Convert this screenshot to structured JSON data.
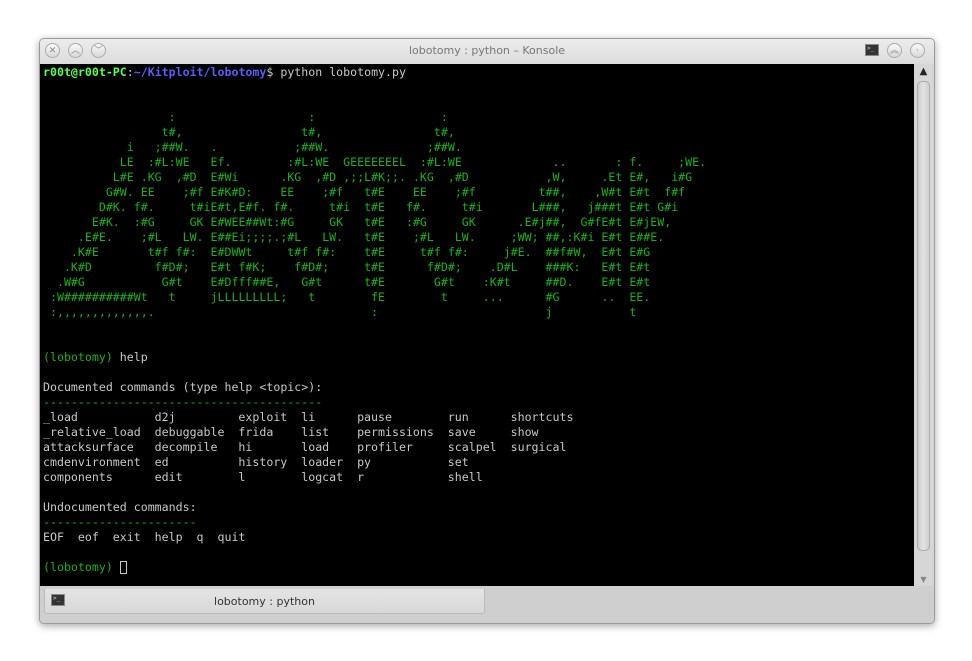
{
  "window": {
    "title": "lobotomy : python – Konsole"
  },
  "terminal": {
    "prompt_user": "r00t@r00t-PC",
    "prompt_sep": ":",
    "prompt_path": "~/Kitploit/lobotomy",
    "prompt_command": "$ python lobotomy.py",
    "art": {
      "lines": [
        "                  :                   :                  :",
        "                 t#,                 t#,                t#,",
        "            i   ;##W.   .           ;##W.              ;##W.",
        "           LE  :#L:WE   Ef.        :#L:WE  GEEEEEEEL  :#L:WE             ..       : f.     ;WE.",
        "          L#E .KG  ,#D  E#Wi      .KG  ,#D ,;;L#K;;. .KG  ,#D           ,W,     .Et E#,   i#G",
        "         G#W. EE    ;#f E#K#D:    EE    ;#f   t#E    EE    ;#f         t##,    ,W#t E#t  f#f",
        "        D#K. f#.     t#iE#t,E#f. f#.     t#i  t#E   f#.     t#i       L###,   j###t E#t G#i",
        "       E#K.  :#G     GK E#WEE##Wt:#G     GK   t#E   :#G     GK      .E#j##,  G#fE#t E#jEW,",
        "     .E#E.    ;#L   LW. E##Ei;;;;.;#L   LW.   t#E    ;#L   LW.     ;WW; ##,:K#i E#t E##E.",
        "    .K#E       t#f f#:  E#DWWt     t#f f#:    t#E     t#f f#:     j#E.  ##f#W,  E#t E#G",
        "   .K#D         f#D#;   E#t f#K;    f#D#;     t#E      f#D#;    .D#L    ###K:   E#t E#t",
        "  .W#G           G#t    E#Dfff##E,   G#t      t#E       G#t    :K#t     ##D.    E#t E#t",
        " :W##########Wt   t     jLLLLLLLLL;   t        fE        t     ...      #G      ..  EE.",
        " :,,,,,,,,,,,,,.                               :                        j           t"
      ]
    },
    "repl_prompt": "(lobotomy)",
    "help_command": " help",
    "documented_header": "Documented commands (type help <topic>):",
    "documented_rule": "========================================",
    "documented_commands": [
      [
        "_load",
        "d2j",
        "exploit",
        "li",
        "pause",
        "run",
        "shortcuts"
      ],
      [
        "_relative_load",
        "debuggable",
        "frida",
        "list",
        "permissions",
        "save",
        "show"
      ],
      [
        "attacksurface",
        "decompile",
        "hi",
        "load",
        "profiler",
        "scalpel",
        "surgical"
      ],
      [
        "cmdenvironment",
        "ed",
        "history",
        "loader",
        "py",
        "set",
        ""
      ],
      [
        "components",
        "edit",
        "l",
        "logcat",
        "r",
        "shell",
        ""
      ]
    ],
    "undocumented_header": "Undocumented commands:",
    "undocumented_rule": "======================",
    "undocumented_commands": "EOF  eof  exit  help  q  quit"
  },
  "tabs": [
    {
      "label": "lobotomy : python"
    }
  ],
  "colors": {
    "art_green": "#18b218",
    "user_green": "#54ff54",
    "path_blue": "#5c5cff",
    "text": "#c8c8c8"
  }
}
